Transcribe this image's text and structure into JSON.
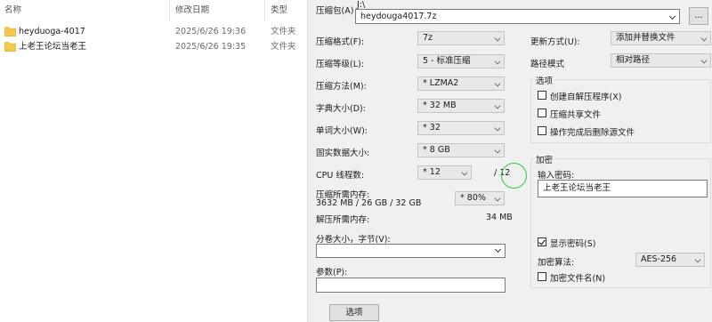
{
  "explorer": {
    "headers": {
      "name": "名称",
      "date": "修改日期",
      "type": "类型"
    },
    "files": [
      {
        "name": "heyduoga-4017",
        "date": "2025/6/26 19:36",
        "type": "文件夹"
      },
      {
        "name": "上老王论坛当老王",
        "date": "2025/6/26 19:35",
        "type": "文件夹"
      }
    ]
  },
  "dialog": {
    "archive_label": "压缩包(A)",
    "archive_path": "J:\\",
    "archive_name": "heydouga4017.7z",
    "browse_label": "...",
    "format_label": "压缩格式(F):",
    "format_value": "7z",
    "level_label": "压缩等级(L):",
    "level_value": "5 - 标准压缩",
    "method_label": "压缩方法(M):",
    "method_value": "* LZMA2",
    "dict_label": "字典大小(D):",
    "dict_value": "* 32 MB",
    "word_label": "单词大小(W):",
    "word_value": "* 32",
    "solid_label": "固实数据大小:",
    "solid_value": "* 8 GB",
    "threads_label": "CPU 线程数:",
    "threads_value": "* 12",
    "threads_max": "/ 12",
    "mem_label": "压缩所需内存:",
    "mem_info": "3632 MB / 26 GB / 32 GB",
    "mem_percent": "* 80%",
    "decomp_label": "解压所需内存:",
    "decomp_value": "34 MB",
    "split_label": "分卷大小，字节(V):",
    "split_value": "",
    "params_label": "参数(P):",
    "params_value": "",
    "options_button": "选项",
    "update_label": "更新方式(U):",
    "update_value": "添加并替换文件",
    "pathmode_label": "路径模式",
    "pathmode_value": "相对路径",
    "options_group": "选项",
    "opt_sfx": "创建自解压程序(X)",
    "opt_shared": "压缩共享文件",
    "opt_delete": "操作完成后删除源文件",
    "encrypt_group": "加密",
    "password_label": "输入密码:",
    "password_value": "上老王论坛当老王",
    "show_password": "显示密码(S)",
    "enc_method_label": "加密算法:",
    "enc_method_value": "AES-256",
    "enc_names": "加密文件名(N)"
  },
  "colors": {
    "dialog_bg": "#f0f0f0",
    "cursor_ring": "#2ecc40",
    "folder": "#f2c94c"
  }
}
